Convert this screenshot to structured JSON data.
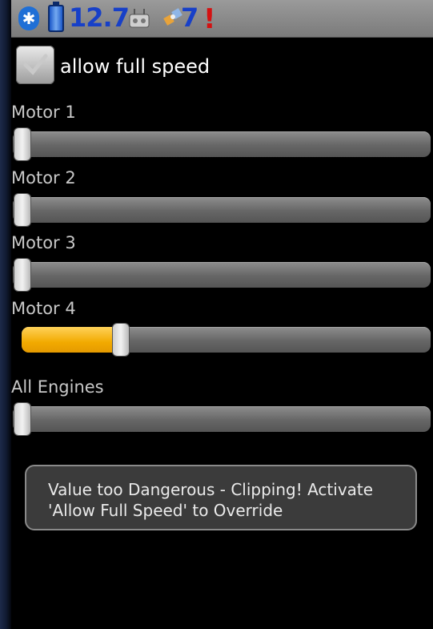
{
  "status_bar": {
    "bluetooth_icon": "bluetooth-icon",
    "battery_icon": "battery-icon",
    "voltage": "12.7",
    "remote_icon": "remote-control-icon",
    "satellite_icon": "satellite-icon",
    "satellites": "7",
    "alert": "!"
  },
  "checkbox": {
    "label": "allow full speed",
    "checked": true
  },
  "sliders": [
    {
      "label": "Motor 1",
      "value": 0.0
    },
    {
      "label": "Motor 2",
      "value": 0.0
    },
    {
      "label": "Motor 3",
      "value": 0.0
    },
    {
      "label": "Motor 4",
      "value": 0.23
    },
    {
      "label": "All Engines",
      "value": 0.0
    }
  ],
  "toast": {
    "text": "Value too Dangerous - Clipping! Activate 'Allow Full Speed' to Override"
  },
  "colors": {
    "fill": "#f2aa00",
    "status_text": "#1740c8",
    "alert": "#d41111"
  }
}
